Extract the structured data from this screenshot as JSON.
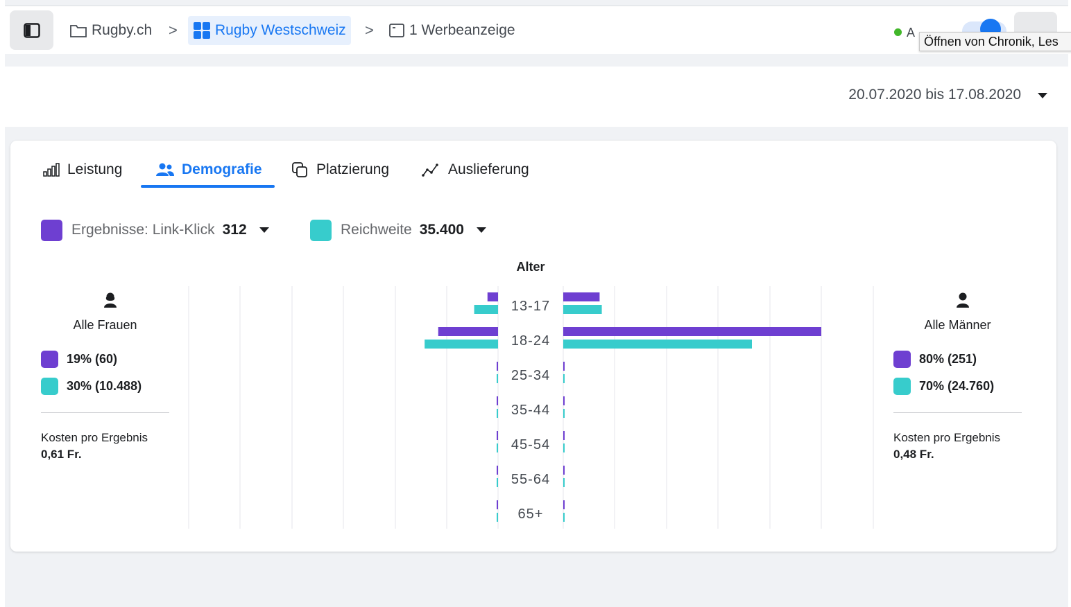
{
  "topbar": {
    "breadcrumbs": [
      {
        "label": "Rugby.ch",
        "icon": "folder-icon"
      },
      {
        "label": "Rugby Westschweiz",
        "icon": "campaign-grid-icon"
      },
      {
        "label": "1 Werbeanzeige",
        "icon": "ad-icon"
      }
    ],
    "separator": ">",
    "status_text": "A",
    "tooltip": "Öffnen von Chronik, Les"
  },
  "date_filter": {
    "range": "20.07.2020 bis 17.08.2020"
  },
  "tabs": [
    {
      "label": "Leistung",
      "icon": "bar-chart-icon",
      "active": false
    },
    {
      "label": "Demografie",
      "icon": "people-icon",
      "active": true
    },
    {
      "label": "Platzierung",
      "icon": "placement-icon",
      "active": false
    },
    {
      "label": "Auslieferung",
      "icon": "delivery-icon",
      "active": false
    }
  ],
  "metrics": [
    {
      "label": "Ergebnisse: Link-Klick",
      "value": "312",
      "color": "#6e3fd1"
    },
    {
      "label": "Reichweite",
      "value": "35.400",
      "color": "#37cccc"
    }
  ],
  "women": {
    "label": "Alle Frauen",
    "results": "19% (60)",
    "reach": "30% (10.488)",
    "cost_label": "Kosten pro Ergebnis",
    "cost_value": "0,61 Fr."
  },
  "men": {
    "label": "Alle Männer",
    "results": "80% (251)",
    "reach": "70% (24.760)",
    "cost_label": "Kosten pro Ergebnis",
    "cost_value": "0,48 Fr."
  },
  "chart_data": {
    "type": "bar",
    "title": "Alter",
    "categories": [
      "13-17",
      "18-24",
      "25-34",
      "35-44",
      "45-54",
      "55-64",
      "65+"
    ],
    "series": [
      {
        "name": "Frauen · Ergebnisse: Link-Klick",
        "values": [
          9,
          51,
          0,
          0,
          0,
          0,
          0
        ],
        "color": "#6e3fd1"
      },
      {
        "name": "Frauen · Reichweite",
        "values": [
          2600,
          8000,
          0,
          0,
          0,
          0,
          0
        ],
        "color": "#37cccc"
      },
      {
        "name": "Männer · Ergebnisse: Link-Klick",
        "values": [
          31,
          220,
          0,
          0,
          0,
          0,
          0
        ],
        "color": "#6e3fd1"
      },
      {
        "name": "Männer · Reichweite",
        "values": [
          4200,
          20560,
          0,
          0,
          0,
          0,
          0
        ],
        "color": "#37cccc"
      }
    ],
    "grid": true
  }
}
